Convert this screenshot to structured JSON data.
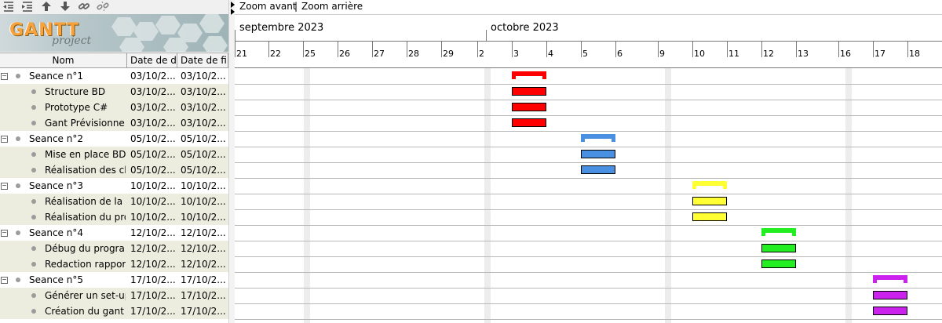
{
  "toolbar": {
    "icons": [
      "outdent-icon",
      "indent-icon",
      "move-up-icon",
      "move-down-icon",
      "link-icon",
      "unlink-icon"
    ]
  },
  "logo": {
    "brand": "GANTT",
    "sub": "project"
  },
  "columns": {
    "name": "Nom",
    "start": "Date de d...",
    "end": "Date de fin"
  },
  "zoom": {
    "in": "Zoom avant",
    "separator": "|",
    "out": "Zoom arrière"
  },
  "timeline": {
    "months": [
      "septembre 2023",
      "octobre 2023"
    ],
    "days": [
      "21",
      "22",
      "25",
      "26",
      "27",
      "28",
      "29",
      "2",
      "3",
      "4",
      "5",
      "6",
      "9",
      "10",
      "11",
      "12",
      "13",
      "16",
      "17",
      "18"
    ]
  },
  "colors": {
    "s1": "#ff0000",
    "s2": "#4a90e2",
    "s3": "#ffff33",
    "s4": "#22ee22",
    "s5": "#cc22ee"
  },
  "tasks": [
    {
      "name": "Seance n°1",
      "start": "03/10/2...",
      "end": "03/10/2...",
      "summary": true,
      "bar_start": "3",
      "bar_end": "4",
      "color": "#ff0000"
    },
    {
      "name": "Structure BD",
      "start": "03/10/2...",
      "end": "03/10/2...",
      "summary": false,
      "bar_start": "3",
      "bar_end": "4",
      "color": "#ff0000"
    },
    {
      "name": "Prototype C#",
      "start": "03/10/2...",
      "end": "03/10/2...",
      "summary": false,
      "bar_start": "3",
      "bar_end": "4",
      "color": "#ff0000"
    },
    {
      "name": "Gant Prévisionnel",
      "start": "03/10/2...",
      "end": "03/10/2...",
      "summary": false,
      "bar_start": "3",
      "bar_end": "4",
      "color": "#ff0000"
    },
    {
      "name": "Seance n°2",
      "start": "05/10/2...",
      "end": "05/10/2...",
      "summary": true,
      "bar_start": "5",
      "bar_end": "6",
      "color": "#4a90e2"
    },
    {
      "name": "Mise en place BD",
      "start": "05/10/2...",
      "end": "05/10/2...",
      "summary": false,
      "bar_start": "5",
      "bar_end": "6",
      "color": "#4a90e2"
    },
    {
      "name": "Réalisation des cla...",
      "start": "05/10/2...",
      "end": "05/10/2...",
      "summary": false,
      "bar_start": "5",
      "bar_end": "6",
      "color": "#4a90e2"
    },
    {
      "name": "Seance n°3",
      "start": "10/10/2...",
      "end": "10/10/2...",
      "summary": true,
      "bar_start": "10",
      "bar_end": "11",
      "color": "#ffff33"
    },
    {
      "name": "Réalisation de la c...",
      "start": "10/10/2...",
      "end": "10/10/2...",
      "summary": false,
      "bar_start": "10",
      "bar_end": "11",
      "color": "#ffff33"
    },
    {
      "name": "Réalisation du pro...",
      "start": "10/10/2...",
      "end": "10/10/2...",
      "summary": false,
      "bar_start": "10",
      "bar_end": "11",
      "color": "#ffff33"
    },
    {
      "name": "Seance n°4",
      "start": "12/10/2...",
      "end": "12/10/2...",
      "summary": true,
      "bar_start": "12",
      "bar_end": "13",
      "color": "#22ee22"
    },
    {
      "name": "Débug du progra...",
      "start": "12/10/2...",
      "end": "12/10/2...",
      "summary": false,
      "bar_start": "12",
      "bar_end": "13",
      "color": "#22ee22"
    },
    {
      "name": "Redaction rapport...",
      "start": "12/10/2...",
      "end": "12/10/2...",
      "summary": false,
      "bar_start": "12",
      "bar_end": "13",
      "color": "#22ee22"
    },
    {
      "name": "Seance n°5",
      "start": "17/10/2...",
      "end": "17/10/2...",
      "summary": true,
      "bar_start": "17",
      "bar_end": "18",
      "color": "#cc22ee"
    },
    {
      "name": "Générer un set-up",
      "start": "17/10/2...",
      "end": "17/10/2...",
      "summary": false,
      "bar_start": "17",
      "bar_end": "18",
      "color": "#cc22ee"
    },
    {
      "name": "Création du gant ...",
      "start": "17/10/2...",
      "end": "17/10/2...",
      "summary": false,
      "bar_start": "17",
      "bar_end": "18",
      "color": "#cc22ee"
    }
  ]
}
